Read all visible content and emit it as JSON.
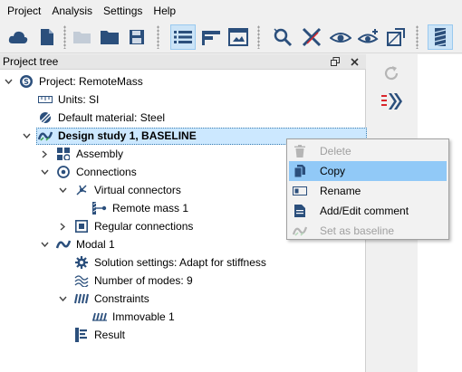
{
  "menu": [
    "Project",
    "Analysis",
    "Settings",
    "Help"
  ],
  "panel": {
    "title": "Project tree"
  },
  "tree": {
    "project": "Project: RemoteMass",
    "units": "Units: SI",
    "material": "Default material: Steel",
    "study": "Design study 1, BASELINE",
    "assembly": "Assembly",
    "connections": "Connections",
    "virtual_connectors": "Virtual connectors",
    "remote_mass": "Remote mass 1",
    "regular_connections": "Regular connections",
    "modal": "Modal 1",
    "solution_settings": "Solution settings: Adapt for stiffness",
    "num_modes": "Number of modes: 9",
    "constraints": "Constraints",
    "immovable": "Immovable 1",
    "result": "Result"
  },
  "context_menu": {
    "delete": "Delete",
    "copy": "Copy",
    "rename": "Rename",
    "add_edit_comment": "Add/Edit comment",
    "set_as_baseline": "Set as baseline"
  },
  "colors": {
    "accent": "#0078d7",
    "selection": "#cce8ff",
    "menu_highlight": "#91c9f7",
    "icon_blue": "#2b4f7c",
    "icon_red": "#d9262c"
  }
}
